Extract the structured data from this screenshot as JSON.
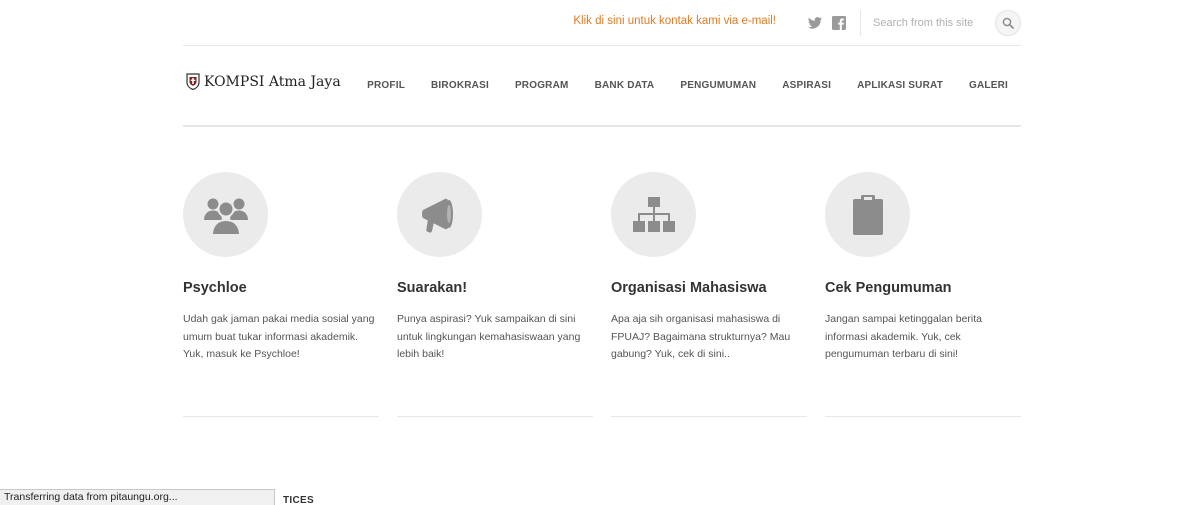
{
  "topbar": {
    "contact_text": "Klik di sini untuk kontak kami via e-mail!",
    "search_placeholder": "Search from this site",
    "twitter_icon": "twitter-icon",
    "facebook_icon": "facebook-icon",
    "search_icon": "search-icon"
  },
  "header": {
    "logo_text": "KOMPSI Atma Jaya",
    "logo_icon": "shield-emblem-icon",
    "nav": [
      {
        "label": "PROFIL"
      },
      {
        "label": "BIROKRASI"
      },
      {
        "label": "PROGRAM"
      },
      {
        "label": "BANK DATA"
      },
      {
        "label": "PENGUMUMAN"
      },
      {
        "label": "ASPIRASI"
      },
      {
        "label": "APLIKASI SURAT"
      },
      {
        "label": "GALERI"
      }
    ]
  },
  "features": [
    {
      "icon": "users-group-icon",
      "title": "Psychloe",
      "desc": "Udah gak jaman pakai media sosial yang umum buat tukar informasi akademik. Yuk, masuk ke Psychloe!"
    },
    {
      "icon": "megaphone-icon",
      "title": "Suarakan!",
      "desc": "Punya aspirasi? Yuk sampaikan di sini untuk lingkungan kemahasiswaan yang lebih baik!"
    },
    {
      "icon": "org-chart-icon",
      "title": "Organisasi Mahasiswa",
      "desc": "Apa aja sih organisasi mahasiswa di FPUAJ? Bagaimana strukturnya? Mau gabung? Yuk, cek di sini.."
    },
    {
      "icon": "clipboard-icon",
      "title": "Cek Pengumuman",
      "desc": "Jangan sampai ketinggalan berita informasi akademik. Yuk, cek pengumuman terbaru di sini!"
    }
  ],
  "colors": {
    "accent": "#e07b22",
    "icon_gray": "#8c8c8c",
    "circle_bg": "#ebebeb"
  },
  "status_bar": "Transferring data from pitaungu.org...",
  "footer_partial": "TICES"
}
